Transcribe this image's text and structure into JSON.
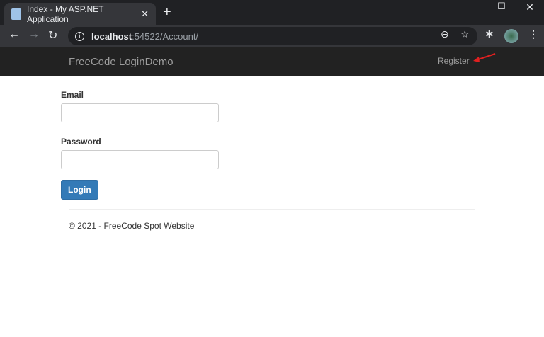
{
  "browser": {
    "tab_title": "Index - My ASP.NET Application",
    "url_host": "localhost",
    "url_path": ":54522/Account/"
  },
  "navbar": {
    "brand": "FreeCode LoginDemo",
    "register": "Register",
    "arrow_color": "#e02020"
  },
  "form": {
    "email_label": "Email",
    "email_value": "",
    "password_label": "Password",
    "password_value": "",
    "login_label": "Login"
  },
  "footer": {
    "text": "© 2021 - FreeCode Spot Website"
  }
}
